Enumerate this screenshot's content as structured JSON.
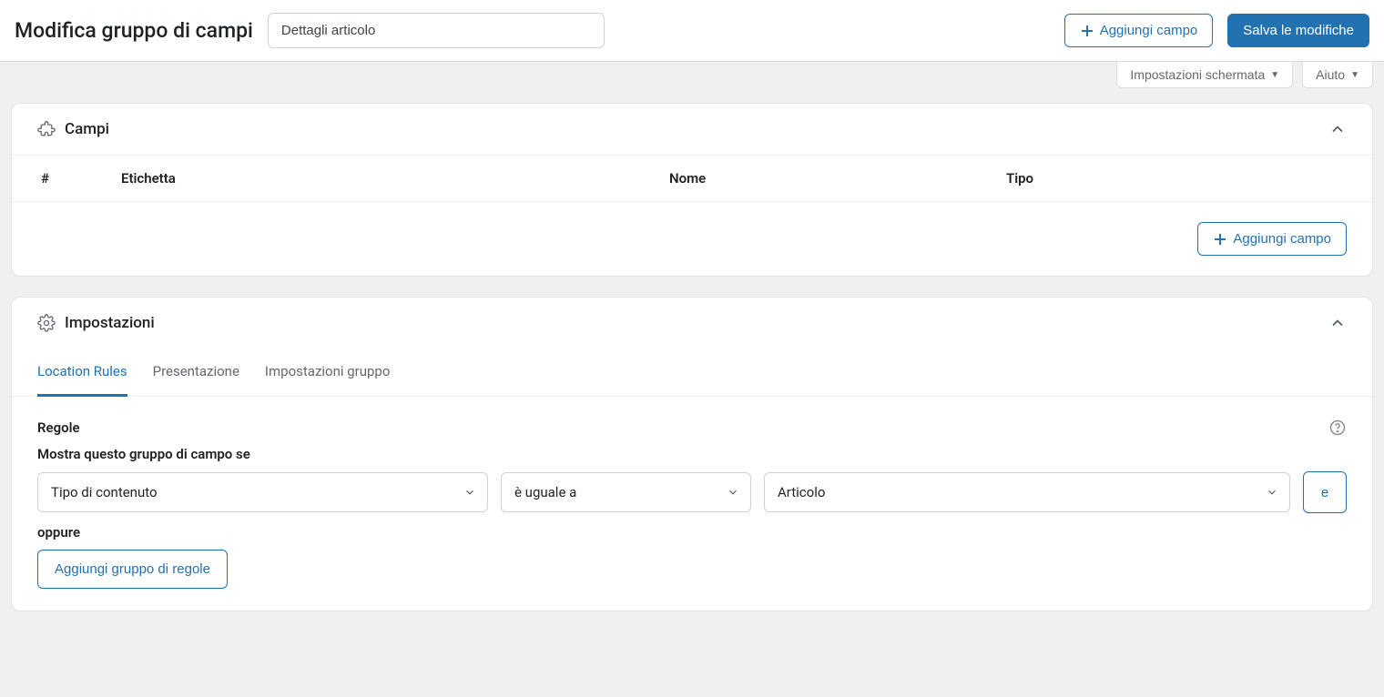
{
  "header": {
    "title": "Modifica gruppo di campi",
    "title_input_value": "Dettagli articolo",
    "add_field_label": "Aggiungi campo",
    "save_label": "Salva le modifiche"
  },
  "screen_meta": {
    "screen_options": "Impostazioni schermata",
    "help": "Aiuto"
  },
  "fields_panel": {
    "title": "Campi",
    "columns": {
      "num": "#",
      "label": "Etichetta",
      "name": "Nome",
      "type": "Tipo"
    },
    "add_field_label": "Aggiungi campo"
  },
  "settings_panel": {
    "title": "Impostazioni",
    "tabs": [
      {
        "label": "Location Rules",
        "active": true
      },
      {
        "label": "Presentazione",
        "active": false
      },
      {
        "label": "Impostazioni gruppo",
        "active": false
      }
    ],
    "rules": {
      "heading": "Regole",
      "subheading": "Mostra questo gruppo di campo se",
      "row": {
        "param": "Tipo di contenuto",
        "operator": "è uguale a",
        "value": "Articolo"
      },
      "and_label": "e",
      "or_label": "oppure",
      "add_group_label": "Aggiungi gruppo di regole"
    }
  }
}
